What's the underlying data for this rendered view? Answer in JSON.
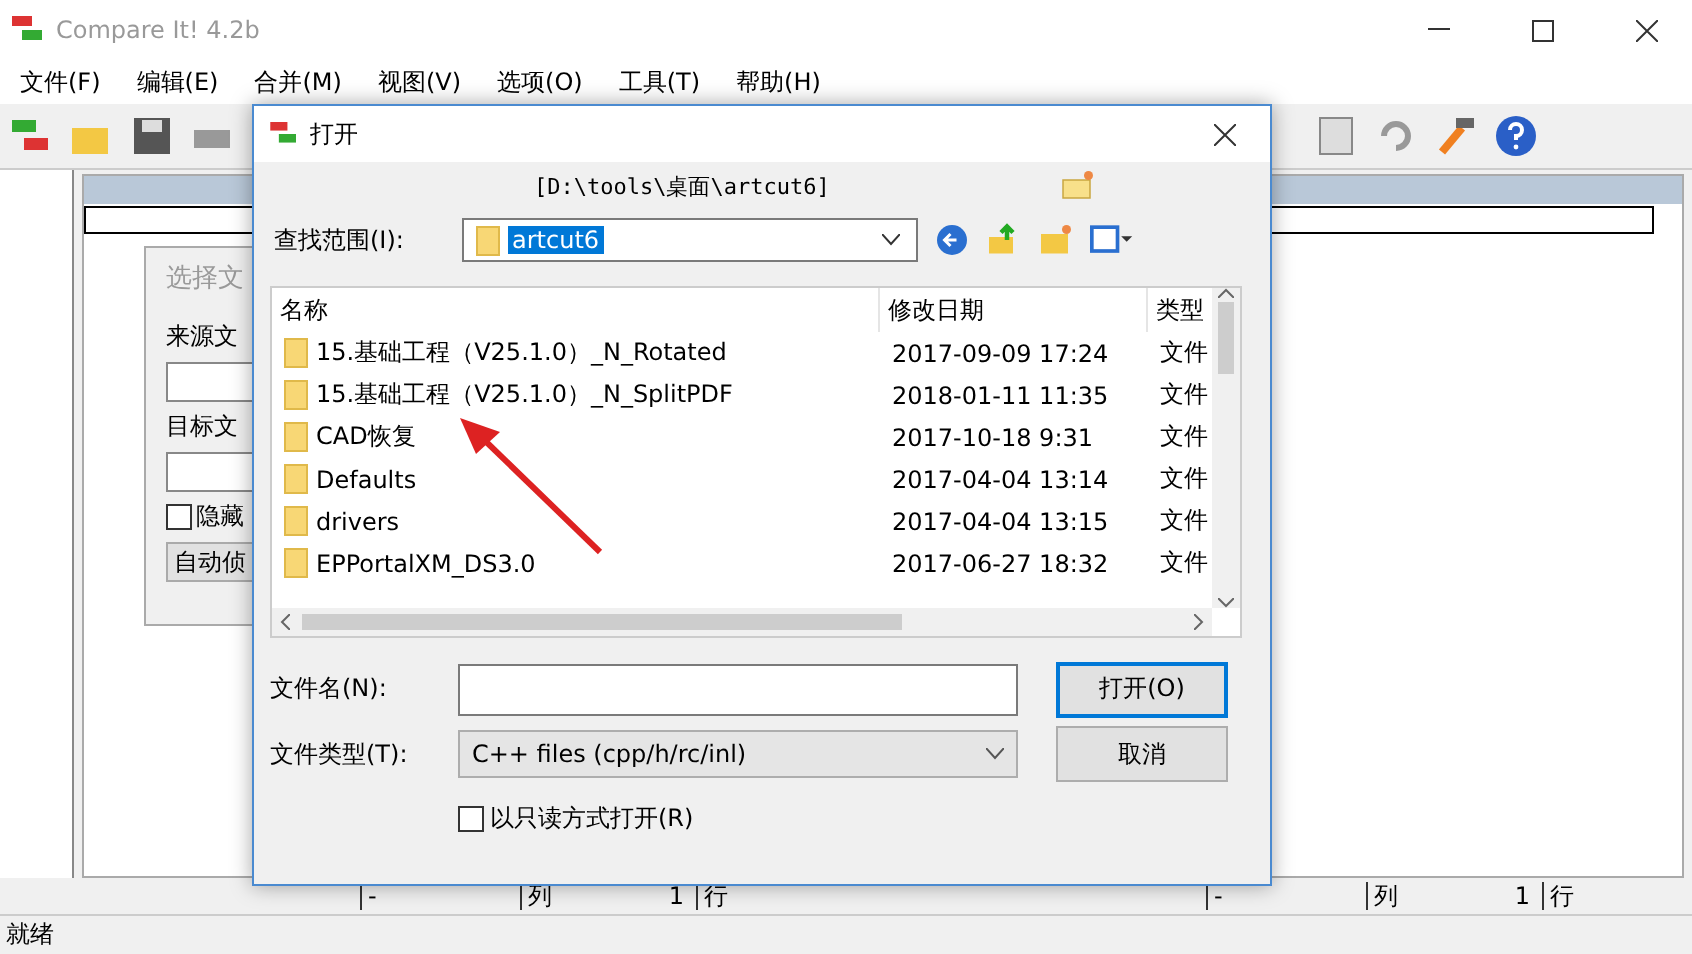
{
  "window": {
    "title": "Compare It! 4.2b"
  },
  "menu": [
    "文件(F)",
    "编辑(E)",
    "合并(M)",
    "视图(V)",
    "选项(O)",
    "工具(T)",
    "帮助(H)"
  ],
  "background_dialog": {
    "title": "选择文",
    "labels": [
      "来源文",
      "目标文"
    ],
    "checkbox": {
      "label": "隐藏",
      "checked": false
    },
    "button": "自动侦"
  },
  "pane_status": [
    {
      "dash": "-",
      "col_label": "列",
      "col": "1",
      "row_label": "行"
    },
    {
      "dash": "-",
      "col_label": "列",
      "col": "1",
      "row_label": "行"
    }
  ],
  "status_bar": "就绪",
  "open_dialog": {
    "title": "打开",
    "path": "[D:\\tools\\桌面\\artcut6]",
    "look_in_label": "查找范围(I):",
    "look_in": "artcut6",
    "columns": [
      "名称",
      "修改日期",
      "类型"
    ],
    "rows": [
      {
        "name": "15.基础工程（V25.1.0）_N_Rotated",
        "date": "2017-09-09 17:24",
        "type": "文件"
      },
      {
        "name": "15.基础工程（V25.1.0）_N_SplitPDF",
        "date": "2018-01-11 11:35",
        "type": "文件"
      },
      {
        "name": "CAD恢复",
        "date": "2017-10-18 9:31",
        "type": "文件"
      },
      {
        "name": "Defaults",
        "date": "2017-04-04 13:14",
        "type": "文件"
      },
      {
        "name": "drivers",
        "date": "2017-04-04 13:15",
        "type": "文件"
      },
      {
        "name": "EPPortalXM_DS3.0",
        "date": "2017-06-27 18:32",
        "type": "文件"
      }
    ],
    "file_name_label": "文件名(N):",
    "file_type_label": "文件类型(T):",
    "file_type": "C++ files (cpp/h/rc/inl)",
    "open_button": "打开(O)",
    "cancel_button": "取消",
    "read_only": {
      "label": "以只读方式打开(R)",
      "checked": false
    }
  }
}
